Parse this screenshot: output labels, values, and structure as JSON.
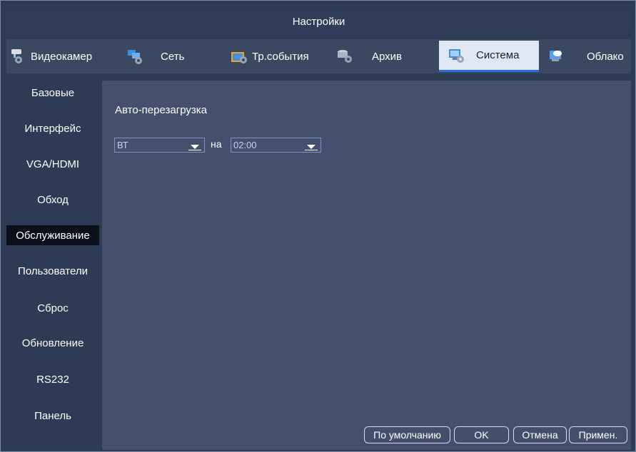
{
  "window": {
    "title": "Настройки"
  },
  "tabs": [
    {
      "label": "Видеокамер",
      "icon": "camera-gear-icon",
      "active": false
    },
    {
      "label": "Сеть",
      "icon": "network-gear-icon",
      "active": false
    },
    {
      "label": "Тр.события",
      "icon": "alarm-gear-icon",
      "active": false
    },
    {
      "label": "Архив",
      "icon": "storage-gear-icon",
      "active": false
    },
    {
      "label": "Система",
      "icon": "system-gear-icon",
      "active": true
    },
    {
      "label": "Облако",
      "icon": "cloud-icon",
      "active": false
    }
  ],
  "sidebar": {
    "items": [
      {
        "label": "Базовые"
      },
      {
        "label": "Интерфейс"
      },
      {
        "label": "VGA/HDMI"
      },
      {
        "label": "Обход"
      },
      {
        "label": "Обслуживание",
        "active": true
      },
      {
        "label": "Пользователи"
      },
      {
        "label": "Сброс"
      },
      {
        "label": "Обновление"
      },
      {
        "label": "RS232"
      },
      {
        "label": "Панель"
      }
    ]
  },
  "content": {
    "auto_reboot_label": "Авто-перезагрузка",
    "day_select": {
      "value": "ВТ"
    },
    "at_label": "на",
    "time_select": {
      "value": "02:00"
    }
  },
  "buttons": {
    "default": "По умолчанию",
    "ok": "OK",
    "cancel": "Отмена",
    "apply": "Примен."
  },
  "colors": {
    "background": "#2e3b55",
    "panel": "#44506e",
    "active_tab": "#dfe7f3",
    "active_tab_accent": "#2a72d8",
    "active_sidebar": "#0a0f1a"
  }
}
